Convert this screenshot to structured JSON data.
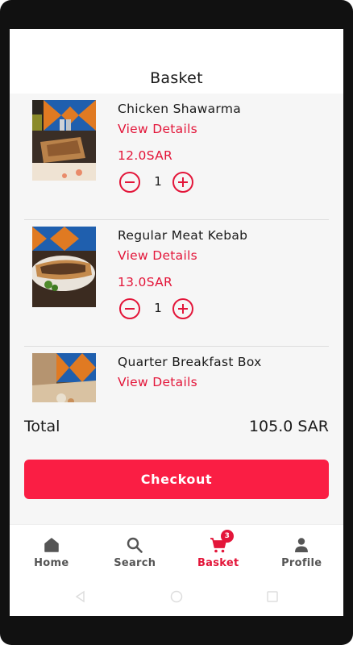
{
  "header": {
    "title": "Basket"
  },
  "items": [
    {
      "name": "Chicken Shawarma",
      "details_label": "View Details",
      "price": "12.0SAR",
      "quantity": "1"
    },
    {
      "name": "Regular Meat Kebab",
      "details_label": "View Details",
      "price": "13.0SAR",
      "quantity": "1"
    },
    {
      "name": "Quarter Breakfast Box",
      "details_label": "View Details"
    }
  ],
  "total": {
    "label": "Total",
    "value": "105.0 SAR"
  },
  "checkout": {
    "label": "Checkout"
  },
  "nav": {
    "items": [
      {
        "label": "Home",
        "icon": "home-icon"
      },
      {
        "label": "Search",
        "icon": "search-icon"
      },
      {
        "label": "Basket",
        "icon": "cart-icon",
        "badge": "3",
        "active": true
      },
      {
        "label": "Profile",
        "icon": "profile-icon"
      }
    ]
  },
  "colors": {
    "accent": "#e3163a",
    "checkout_bg": "#fa1e44",
    "list_bg": "#f6f6f6"
  }
}
